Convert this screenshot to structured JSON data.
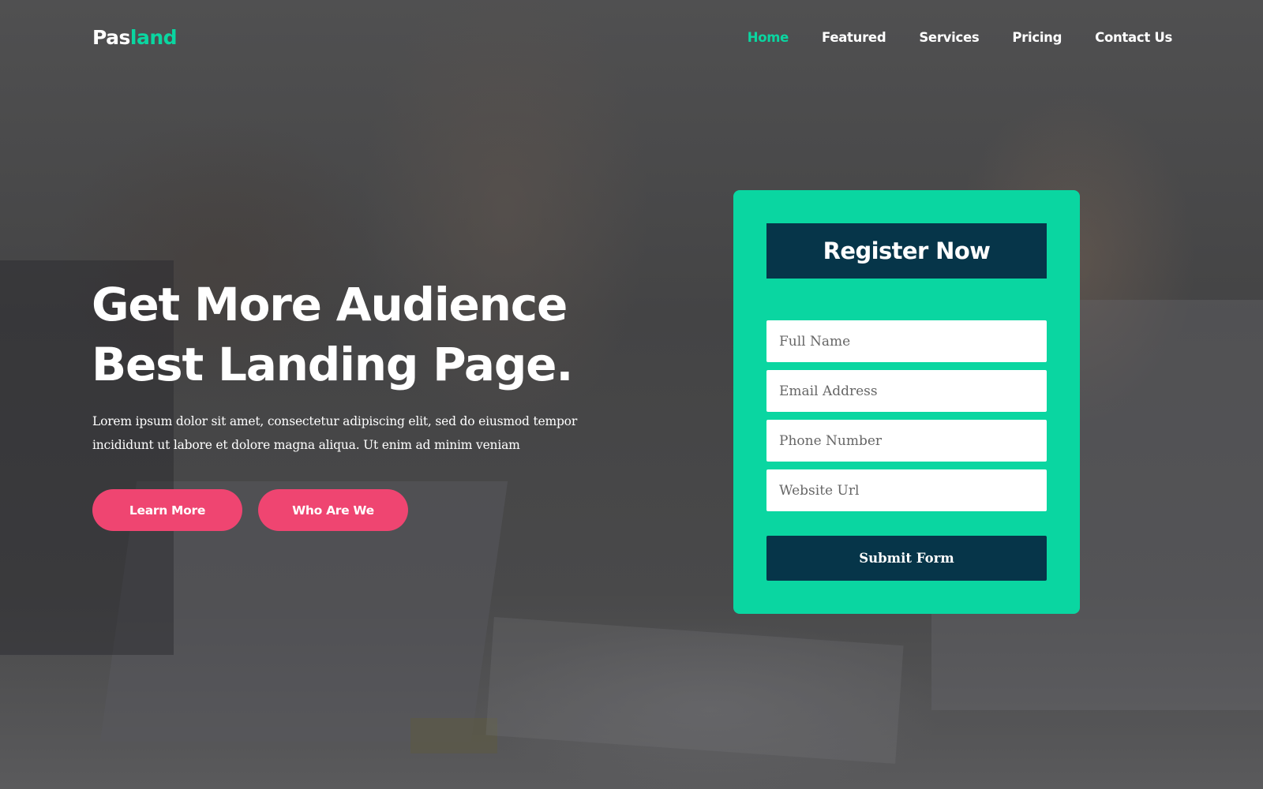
{
  "brand": {
    "logo_part1": "Pas",
    "logo_part2": "land",
    "accent_color": "#0ad6a1"
  },
  "nav": {
    "items": [
      {
        "label": "Home",
        "active": true
      },
      {
        "label": "Featured",
        "active": false
      },
      {
        "label": "Services",
        "active": false
      },
      {
        "label": "Pricing",
        "active": false
      },
      {
        "label": "Contact Us",
        "active": false
      }
    ]
  },
  "hero": {
    "title_line1": "Get More Audience",
    "title_line2": "Best Landing Page.",
    "description": "Lorem ipsum dolor sit amet, consectetur adipiscing elit, sed do eiusmod tempor incididunt ut labore et dolore magna aliqua. Ut enim ad minim veniam",
    "primary_button": "Learn More",
    "secondary_button": "Who Are We",
    "button_color": "#ef4571"
  },
  "register": {
    "title": "Register Now",
    "card_color": "#0ad6a1",
    "dark_color": "#063549",
    "fields": {
      "full_name": {
        "placeholder": "Full Name",
        "value": ""
      },
      "email": {
        "placeholder": "Email Address",
        "value": ""
      },
      "phone": {
        "placeholder": "Phone Number",
        "value": ""
      },
      "website": {
        "placeholder": "Website Url",
        "value": ""
      }
    },
    "submit_label": "Submit Form"
  }
}
